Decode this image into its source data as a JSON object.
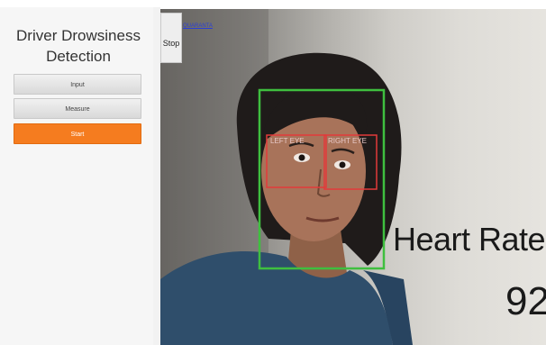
{
  "app": {
    "title_line1": "Driver Drowsiness",
    "title_line2": "Detection"
  },
  "sidebar": {
    "buttons": [
      {
        "label": "Input"
      },
      {
        "label": "Measure"
      },
      {
        "label": "Start"
      }
    ]
  },
  "video": {
    "stop_label": "Stop",
    "top_link": "QUARANTA",
    "heart_rate_label": "Heart Rate",
    "heart_rate_value": "92",
    "eye_left_label": "LEFT EYE",
    "eye_right_label": "RIGHT EYE"
  },
  "colors": {
    "face_box": "#3fbf3f",
    "eye_box": "#e23a3a",
    "active_button": "#f57c1f"
  }
}
